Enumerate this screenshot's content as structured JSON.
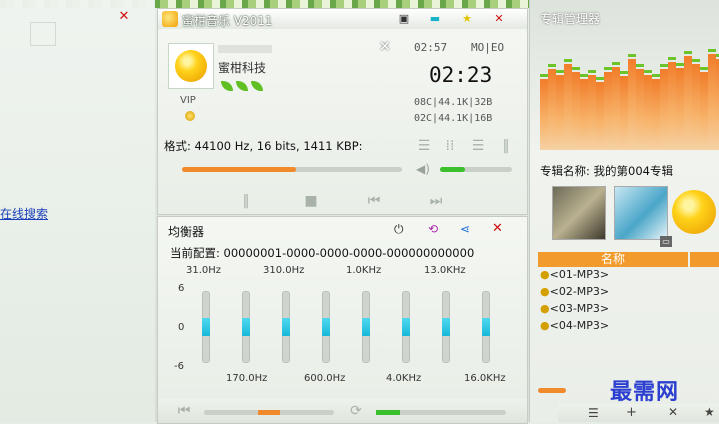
{
  "left_panel": {
    "link_text": "在线搜索"
  },
  "player": {
    "title": "蜜柑音乐 V2011",
    "company": "蜜柑科技",
    "vip_label": "VIP",
    "elapsed_time": "02:57",
    "mode": "MO|EO",
    "main_time": "02:23",
    "format_line_1": "08C|44.1K|32B",
    "format_line_2": "02C|44.1K|16B",
    "format_text": "格式: 44100 Hz, 16 bits, 1411 KBP:",
    "progress": 0.52,
    "volume": 0.35,
    "close_symbol": "✕"
  },
  "equalizer": {
    "title": "均衡器",
    "preset_text": "当前配置: 00000001-0000-0000-0000-000000000000",
    "top_freqs": [
      "31.0Hz",
      "310.0Hz",
      "1.0KHz",
      "13.0KHz"
    ],
    "bottom_freqs": [
      "170.0Hz",
      "600.0Hz",
      "4.0KHz",
      "16.0KHz"
    ],
    "scale": [
      "6",
      "0",
      "-6"
    ],
    "bands": [
      0,
      0,
      0,
      0,
      0,
      0,
      0,
      0
    ],
    "colors": {
      "knob": "#1ec0e0"
    }
  },
  "album": {
    "title": "专辑管理器",
    "album_name": "专辑名称: 我的第004专辑",
    "list_header": "名称",
    "tracks": [
      "<01-MP3>",
      "<02-MP3>",
      "<03-MP3>",
      "<04-MP3>"
    ],
    "spectrum": [
      0.55,
      0.62,
      0.58,
      0.66,
      0.6,
      0.55,
      0.58,
      0.52,
      0.6,
      0.64,
      0.57,
      0.7,
      0.62,
      0.58,
      0.55,
      0.62,
      0.68,
      0.63,
      0.72,
      0.66,
      0.6,
      0.74,
      0.7
    ],
    "colors": {
      "accent": "#f39a2c",
      "cap": "#6cc42a"
    }
  },
  "watermark": "最需网"
}
